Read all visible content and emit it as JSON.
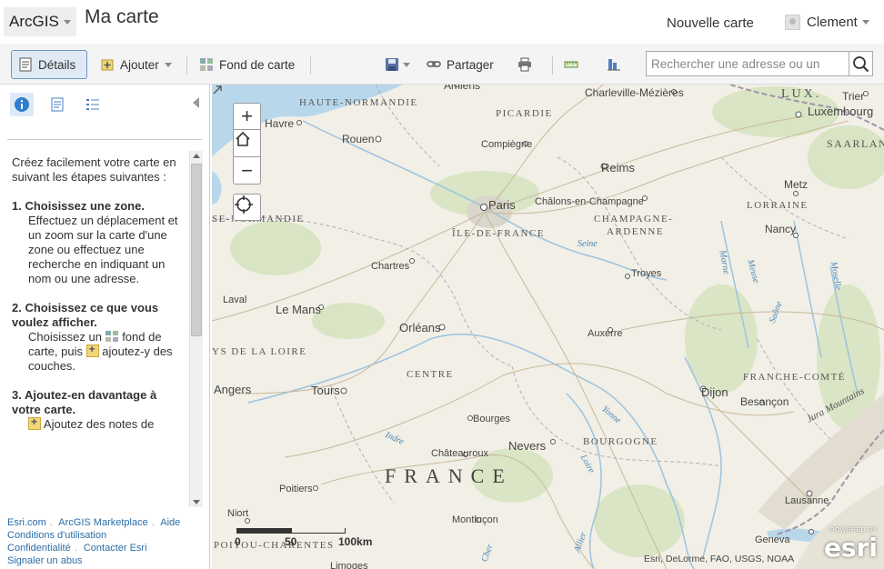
{
  "header": {
    "brand": "ArcGIS",
    "map_title": "Ma carte",
    "new_map": "Nouvelle carte",
    "user_name": "Clement"
  },
  "toolbar": {
    "details": "Détails",
    "add": "Ajouter",
    "basemap": "Fond de carte",
    "share": "Partager",
    "search_placeholder": "Rechercher une adresse ou un"
  },
  "sidebar": {
    "intro": "Créez facilement votre carte en suivant les étapes suivantes :",
    "step1_title": "1. Choisissez une zone.",
    "step1_body": "Effectuez un déplacement et un zoom sur la carte d'une zone ou effectuez une recherche en indiquant un nom ou une adresse.",
    "step2_title": "2. Choisissez ce que vous voulez afficher.",
    "step2_a": "Choisissez un",
    "step2_b": "fond de carte, puis",
    "step2_c": "ajoutez-y des couches.",
    "step3_title": "3. Ajoutez-en davantage à votre carte.",
    "step3_body": "Ajoutez des notes de",
    "footer": {
      "esri": "Esri.com",
      "marketplace": "ArcGIS Marketplace",
      "help": "Aide",
      "terms": "Conditions d'utilisation",
      "privacy": "Confidentialité",
      "contact": "Contacter Esri",
      "report": "Signaler un abus"
    }
  },
  "map": {
    "zoom_in": "+",
    "zoom_out": "−",
    "scale": {
      "zero": "0",
      "fifty": "50",
      "hundred": "100km"
    },
    "attribution": "Esri, DeLorme, FAO, USGS, NOAA",
    "esri_powered": "POWERED BY",
    "esri_word": "esri",
    "labels": {
      "amiens": "Amiens",
      "charleville": "Charleville-Mézières",
      "lux": "LUX.",
      "trier": "Trier",
      "luxembourg": "Luxembourg",
      "haute_normandie": "HAUTE-NORMANDIE",
      "picardie": "PICARDIE",
      "havre": "Havre",
      "rouen": "Rouen",
      "compiegne": "Compiègne",
      "saarland": "SAARLAN",
      "reims": "Reims",
      "metz": "Metz",
      "basse_normandie": "SE-NORMANDIE",
      "paris": "Paris",
      "chalons": "Châlons-en-Champagne",
      "lorraine": "LORRAINE",
      "champagne": "CHAMPAGNE-",
      "ardenne": "ARDENNE",
      "idf": "ÎLE-DE-FRANCE",
      "nancy": "Nancy",
      "seine": "Seine",
      "chartres": "Chartres",
      "troyes": "Troyes",
      "laval": "Laval",
      "le_mans": "Le Mans",
      "orleans": "Orléans",
      "auxerre": "Auxerre",
      "pays_loire": "YS DE LA LOIRE",
      "centre": "CENTRE",
      "franche_comte": "FRANCHE-COMTÉ",
      "angers": "Angers",
      "tours": "Tours",
      "dijon": "Dijon",
      "besancon": "Besançon",
      "bourges": "Bourges",
      "jura": "Jura Mountains",
      "nevers": "Nevers",
      "bourgogne": "BOURGOGNE",
      "indre": "Indre",
      "chateauroux": "Châteauroux",
      "yonne": "Yonne",
      "france": "FRANCE",
      "loire": "Loire",
      "poitiers": "Poitiers",
      "lausanne": "Lausanne",
      "niort": "Niort",
      "montlucon": "Montluçon",
      "geneva": "Geneva",
      "poitou": "POITOU-CHARENTES",
      "limoges": "Limoges",
      "marne": "Marne",
      "meuse": "Meuse",
      "moselle": "Moselle",
      "saone": "Saône",
      "allier": "Allier",
      "cher": "Cher"
    }
  }
}
